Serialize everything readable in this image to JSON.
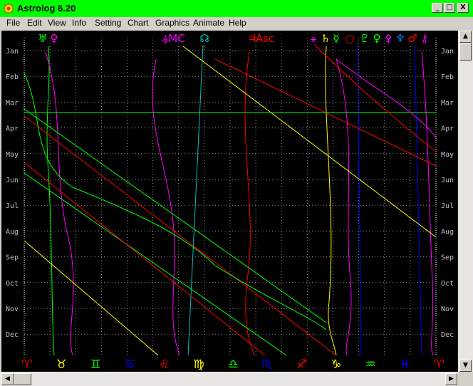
{
  "window": {
    "title": "Astrolog 6.20",
    "controls": {
      "minimize": "_",
      "maximize": "□",
      "close": "X"
    }
  },
  "menu": [
    "File",
    "Edit",
    "View",
    "Info",
    "Setting",
    "Chart",
    "Graphics",
    "Animate",
    "Help"
  ],
  "chart": {
    "months": [
      "Jan",
      "Feb",
      "Mar",
      "Apr",
      "May",
      "Jun",
      "Jul",
      "Aug",
      "Sep",
      "Oct",
      "Nov",
      "Dec"
    ],
    "top_symbols": [
      {
        "text": "♅",
        "color": "#00ff00"
      },
      {
        "text": "♀",
        "color": "#ff00ff"
      },
      {
        "text": "⚶",
        "color": "#ff00ff"
      },
      {
        "text": "MC",
        "color": "#ff00ff"
      },
      {
        "text": "☊",
        "color": "#00c0c0"
      },
      {
        "text": "♃",
        "color": "#ff0000"
      },
      {
        "text": "Asc",
        "color": "#ff0000"
      },
      {
        "text": "⚹",
        "color": "#ff00ff"
      },
      {
        "text": "♄",
        "color": "#ffff00"
      },
      {
        "text": "☿",
        "color": "#00ff00"
      },
      {
        "text": "○",
        "color": "#ff0000"
      },
      {
        "text": "♇",
        "color": "#00ff00"
      },
      {
        "text": "♀",
        "color": "#00ff00"
      },
      {
        "text": "⚴",
        "color": "#ff00ff"
      },
      {
        "text": "♆",
        "color": "#0080ff"
      },
      {
        "text": "♂",
        "color": "#ff0000"
      },
      {
        "text": "⚷",
        "color": "#ff00ff"
      }
    ],
    "zodiac": [
      {
        "sign": "♈",
        "color": "#ff0000"
      },
      {
        "sign": "♉",
        "color": "#ffff00"
      },
      {
        "sign": "♊",
        "color": "#00ff00"
      },
      {
        "sign": "♋",
        "color": "#0000ff"
      },
      {
        "sign": "♌",
        "color": "#ff0000"
      },
      {
        "sign": "♍",
        "color": "#ffff00"
      },
      {
        "sign": "♎",
        "color": "#00ff00"
      },
      {
        "sign": "♏",
        "color": "#0000ff"
      },
      {
        "sign": "♐",
        "color": "#ff0000"
      },
      {
        "sign": "♑",
        "color": "#ffff00"
      },
      {
        "sign": "♒",
        "color": "#00ff00"
      },
      {
        "sign": "♓",
        "color": "#0000ff"
      },
      {
        "sign": "♈",
        "color": "#ff0000"
      }
    ]
  }
}
